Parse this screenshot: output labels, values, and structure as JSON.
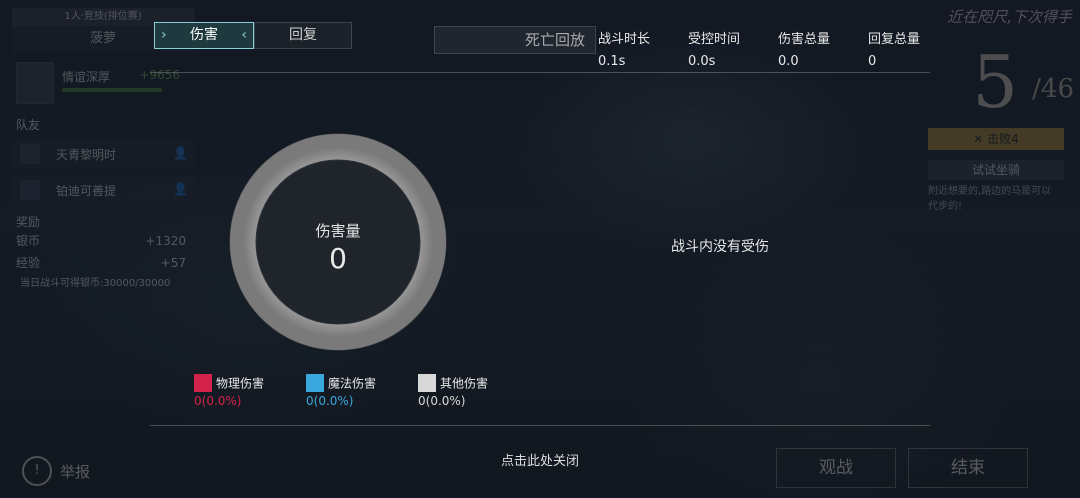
{
  "hud": {
    "left": {
      "top_label": "1人·竞技(排位赛)",
      "title": "菠萝",
      "player_name": "情谊深厚",
      "player_score": "+9656",
      "teammates_heading": "队友",
      "teammates": [
        "天青黎明时",
        "铂迪可善提"
      ],
      "rewards_heading": "奖励",
      "rewards": [
        {
          "label": "银币",
          "value": "+1320"
        },
        {
          "label": "经验",
          "value": "+57"
        }
      ],
      "daily_limit": "当日战斗可得银币:30000/30000"
    },
    "right": {
      "motto": "近在咫尺,下次得手",
      "rank": "5",
      "rank_total": "/46",
      "kill_label": "击败4",
      "try_label": "试试坐骑",
      "tip": "附近想要的,路边的马是可以代步的!"
    },
    "report_label": "举报",
    "spectate_label": "观战",
    "end_label": "结束"
  },
  "panel": {
    "tabs": [
      {
        "label": "伤害",
        "active": true
      },
      {
        "label": "回复",
        "active": false
      }
    ],
    "replay_label": "死亡回放",
    "stats": [
      {
        "label": "战斗时长",
        "value": "0.1s"
      },
      {
        "label": "受控时间",
        "value": "0.0s"
      },
      {
        "label": "伤害总量",
        "value": "0.0"
      },
      {
        "label": "回复总量",
        "value": "0"
      }
    ],
    "donut": {
      "label": "伤害量",
      "value": "0"
    },
    "empty_message": "战斗内没有受伤",
    "legend": [
      {
        "name": "物理伤害",
        "percent": "0(0.0%)",
        "color": "#d4234a"
      },
      {
        "name": "魔法伤害",
        "percent": "0(0.0%)",
        "color": "#3aa8dc"
      },
      {
        "name": "其他伤害",
        "percent": "0(0.0%)",
        "color": "#d8d8d8"
      }
    ],
    "close_hint": "点击此处关闭"
  }
}
